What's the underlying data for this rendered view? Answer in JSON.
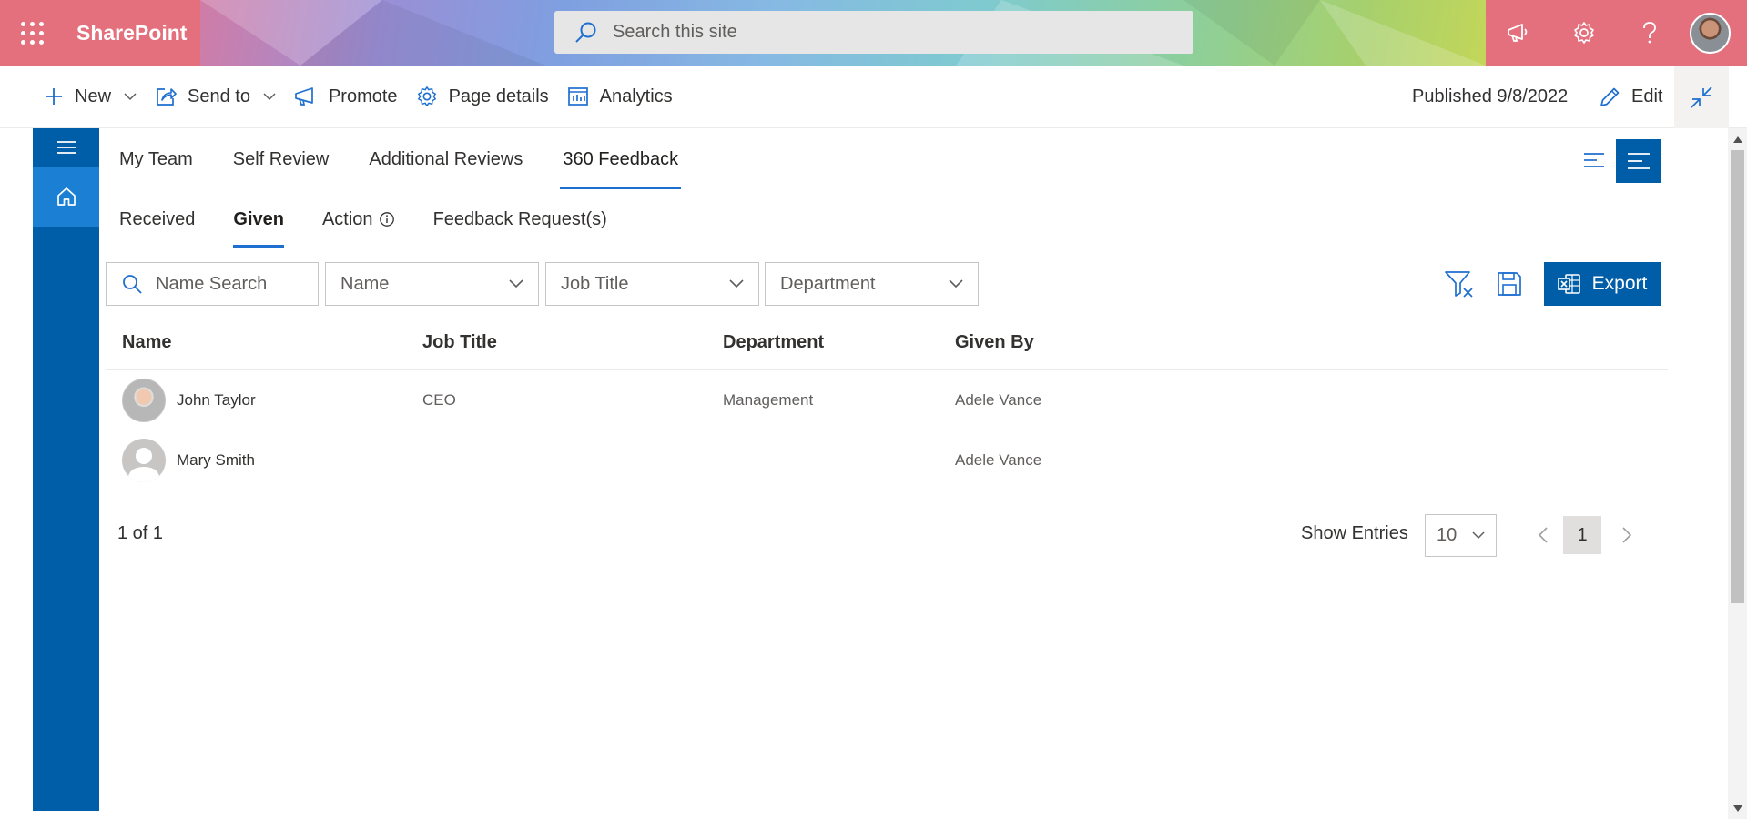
{
  "suitebar": {
    "brand": "SharePoint",
    "search_placeholder": "Search this site",
    "accent_color": "#e3707c"
  },
  "commandbar": {
    "new_label": "New",
    "sendto_label": "Send to",
    "promote_label": "Promote",
    "pagedetails_label": "Page details",
    "analytics_label": "Analytics",
    "published_label": "Published 9/8/2022",
    "edit_label": "Edit"
  },
  "tabs": [
    {
      "label": "My Team"
    },
    {
      "label": "Self Review"
    },
    {
      "label": "Additional Reviews"
    },
    {
      "label": "360 Feedback",
      "active": true
    }
  ],
  "subtabs": [
    {
      "label": "Received"
    },
    {
      "label": "Given",
      "active": true
    },
    {
      "label": "Action"
    },
    {
      "label": "Feedback Request(s)"
    }
  ],
  "filters": {
    "name_search_placeholder": "Name Search",
    "name_dropdown": "Name",
    "jobtitle_dropdown": "Job Title",
    "department_dropdown": "Department",
    "export_label": "Export"
  },
  "table": {
    "columns": [
      "Name",
      "Job Title",
      "Department",
      "Given By"
    ],
    "rows": [
      {
        "name": "John Taylor",
        "job_title": "CEO",
        "department": "Management",
        "given_by": "Adele Vance",
        "avatar": "photo"
      },
      {
        "name": "Mary Smith",
        "job_title": "",
        "department": "",
        "given_by": "Adele Vance",
        "avatar": "generic-person-icon"
      }
    ]
  },
  "pager": {
    "page_count": "1 of 1",
    "show_entries_label": "Show Entries",
    "entries_value": "10",
    "current_page": "1"
  },
  "colors": {
    "primary": "#005da8",
    "rail_active": "#1b7fd4",
    "tab_underline": "#1e6fd0"
  }
}
